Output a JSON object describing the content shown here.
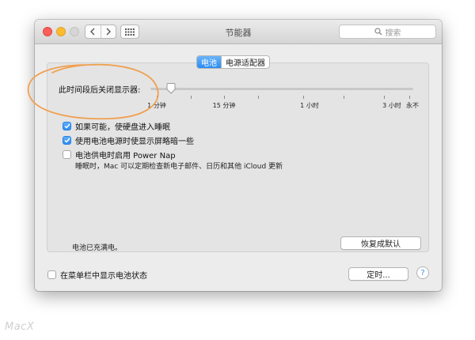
{
  "window": {
    "title": "节能器"
  },
  "search": {
    "placeholder": "搜索",
    "icon": "magnifier-icon"
  },
  "tabs": [
    {
      "label": "电池",
      "active": true
    },
    {
      "label": "电源适配器",
      "active": false
    }
  ],
  "display_sleep": {
    "label": "此时间段后关闭显示器:",
    "ticks": [
      "1 分钟",
      "15 分钟",
      "1 小时",
      "3 小时",
      "永不"
    ]
  },
  "options": [
    {
      "label": "如果可能，使硬盘进入睡眠",
      "checked": true
    },
    {
      "label": "使用电池电源时使显示屏略暗一些",
      "checked": true
    },
    {
      "label": "电池供电时启用 Power Nap",
      "checked": false
    }
  ],
  "power_nap_note": "睡眠时，Mac 可以定期检查新电子邮件、日历和其他 iCloud 更新",
  "battery_status": "电池已充满电。",
  "buttons": {
    "restore_defaults": "恢复成默认",
    "schedule": "定时...",
    "help": "?"
  },
  "menubar_option": {
    "label": "在菜单栏中显示电池状态",
    "checked": false
  },
  "watermark": "MacX",
  "colors": {
    "accent": "#2a8bf3",
    "annotation": "#f0a050"
  }
}
